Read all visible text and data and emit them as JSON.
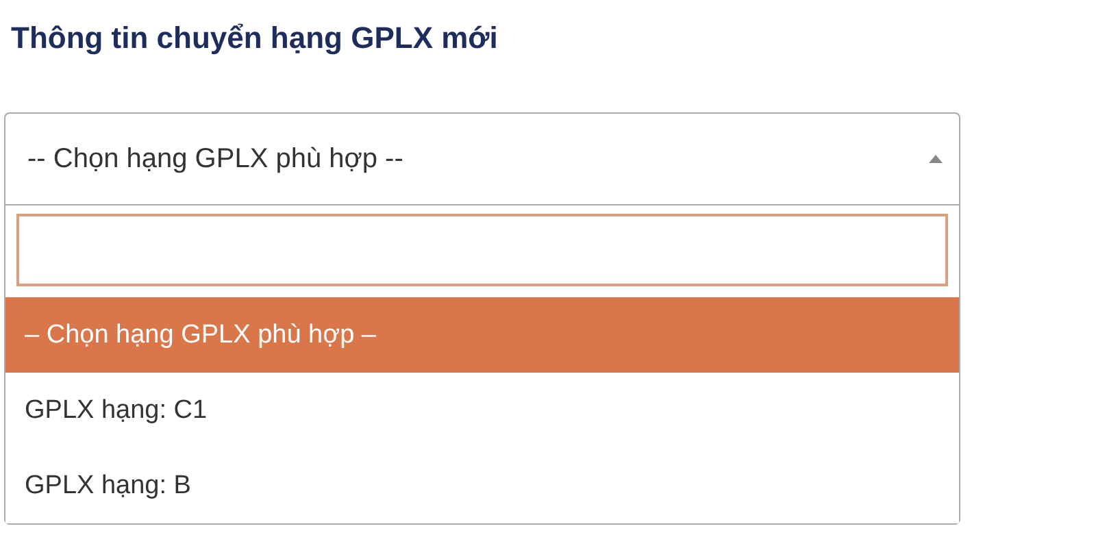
{
  "heading": "Thông tin chuyển hạng GPLX mới",
  "select": {
    "value": "-- Chọn hạng GPLX phù hợp --",
    "expanded": true
  },
  "dropdown": {
    "options": [
      {
        "label": "– Chọn hạng GPLX phù hợp –",
        "selected": true
      },
      {
        "label": "GPLX hạng: C1",
        "selected": false
      },
      {
        "label": "GPLX hạng: B",
        "selected": false
      }
    ]
  }
}
